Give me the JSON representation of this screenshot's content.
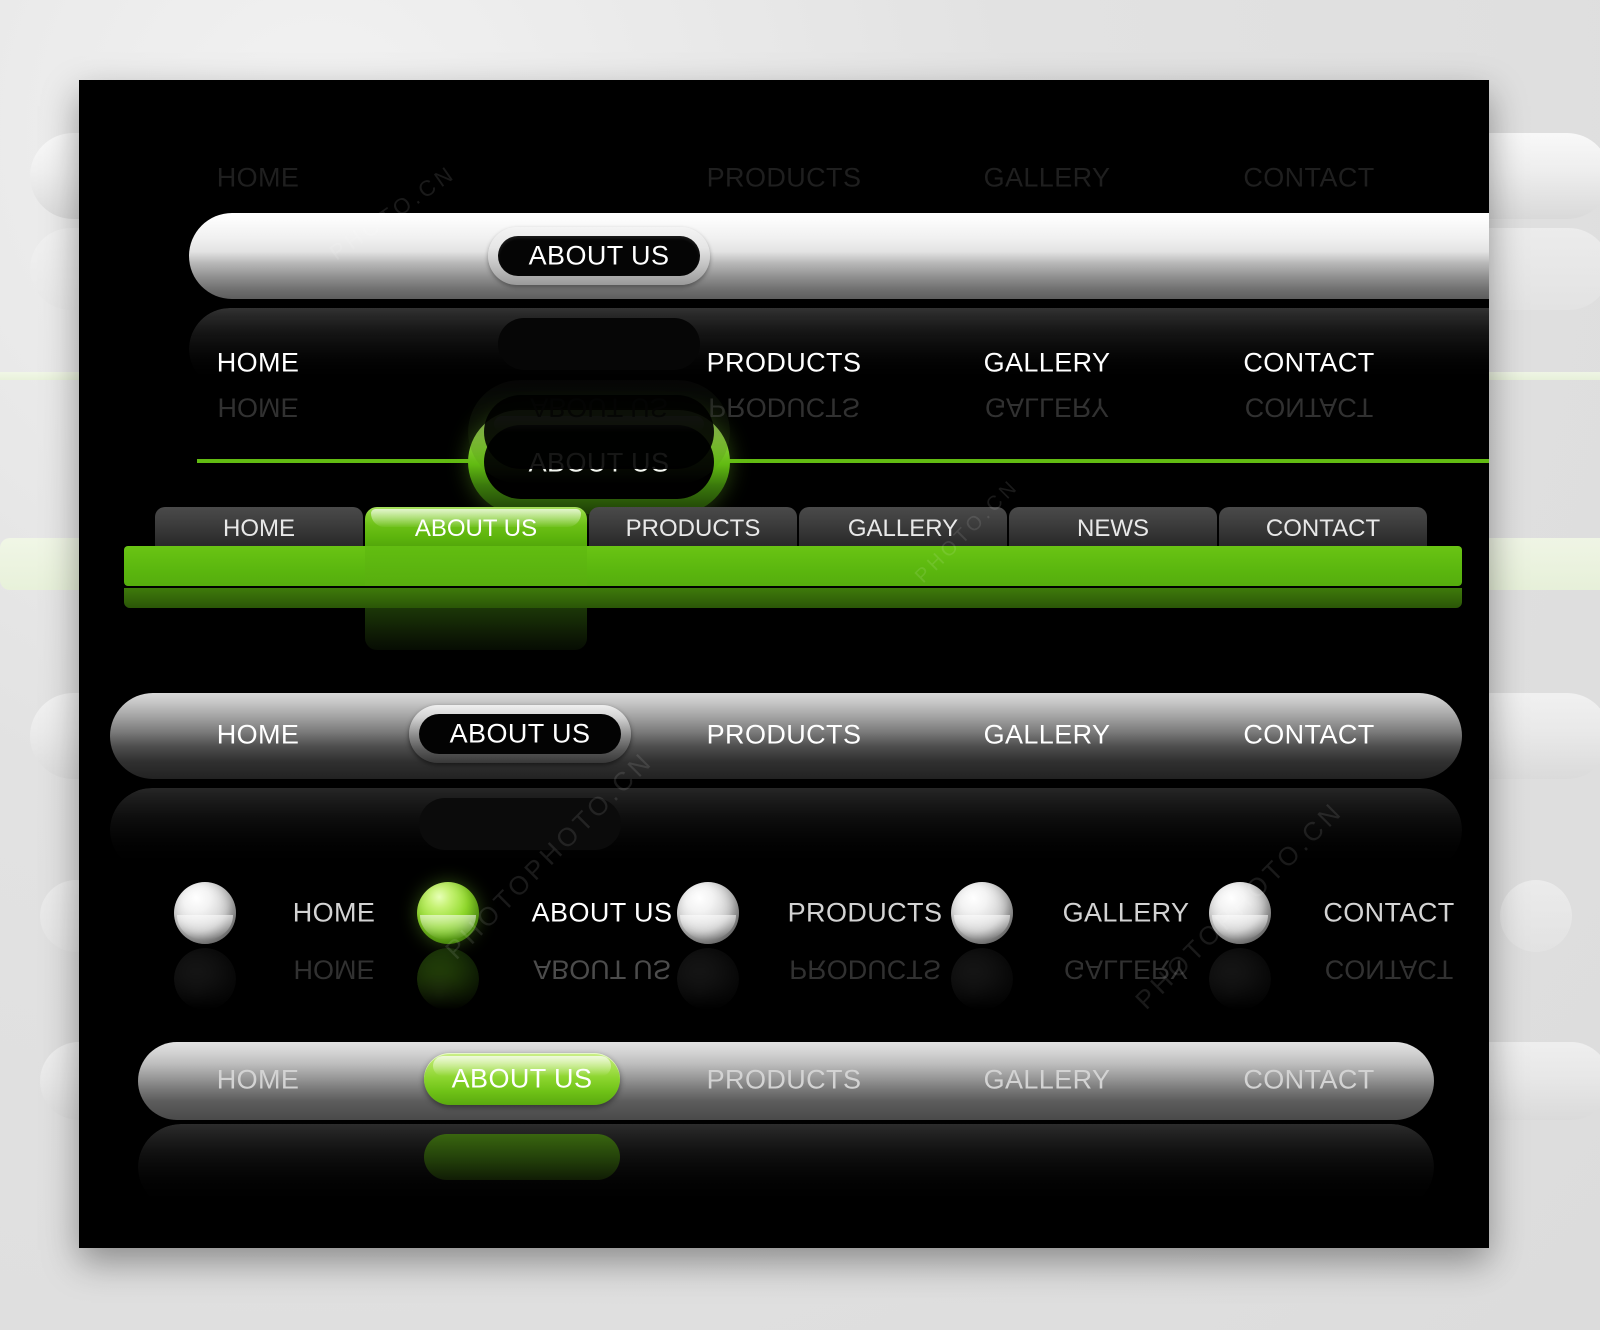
{
  "canvas": {
    "background_color": "#e0e0e0",
    "panel_color": "#000000"
  },
  "colors": {
    "accent_green": "#62bb12",
    "green_bright": "#8bd52e",
    "green_dark": "#3e7a0b",
    "silver_light": "#ffffff",
    "silver_dark": "#5e5e5e",
    "text_dark": "#1f1f1f",
    "text_light": "#ffffff"
  },
  "menus": [
    {
      "id": "menu-silver-pill",
      "style": "silver-pill-bar",
      "active_index": 1,
      "items": [
        {
          "label": "HOME"
        },
        {
          "label": "ABOUT US"
        },
        {
          "label": "PRODUCTS"
        },
        {
          "label": "GALLERY"
        },
        {
          "label": "CONTACT"
        }
      ]
    },
    {
      "id": "menu-green-outline",
      "style": "green-underline-ring",
      "active_index": 1,
      "items": [
        {
          "label": "HOME"
        },
        {
          "label": "ABOUT US"
        },
        {
          "label": "PRODUCTS"
        },
        {
          "label": "GALLERY"
        },
        {
          "label": "CONTACT"
        }
      ]
    },
    {
      "id": "menu-green-tabs",
      "style": "green-tab-strip",
      "active_index": 1,
      "items": [
        {
          "label": "HOME"
        },
        {
          "label": "ABOUT US"
        },
        {
          "label": "PRODUCTS"
        },
        {
          "label": "GALLERY"
        },
        {
          "label": "NEWS"
        },
        {
          "label": "CONTACT"
        }
      ]
    },
    {
      "id": "menu-dark-pill",
      "style": "dark-pill-bar",
      "active_index": 1,
      "items": [
        {
          "label": "HOME"
        },
        {
          "label": "ABOUT US"
        },
        {
          "label": "PRODUCTS"
        },
        {
          "label": "GALLERY"
        },
        {
          "label": "CONTACT"
        }
      ]
    },
    {
      "id": "menu-spheres",
      "style": "glossy-sphere-bullets",
      "active_index": 1,
      "items": [
        {
          "label": "HOME"
        },
        {
          "label": "ABOUT US"
        },
        {
          "label": "PRODUCTS"
        },
        {
          "label": "GALLERY"
        },
        {
          "label": "CONTACT"
        }
      ]
    },
    {
      "id": "menu-grey-green-button",
      "style": "grey-bar-green-button",
      "active_index": 1,
      "items": [
        {
          "label": "HOME"
        },
        {
          "label": "ABOUT US"
        },
        {
          "label": "PRODUCTS"
        },
        {
          "label": "GALLERY"
        },
        {
          "label": "CONTACT"
        }
      ]
    }
  ],
  "watermark": {
    "text_a": "PHOTO.CN",
    "text_b": "PHOTOPHOTO.CN"
  }
}
